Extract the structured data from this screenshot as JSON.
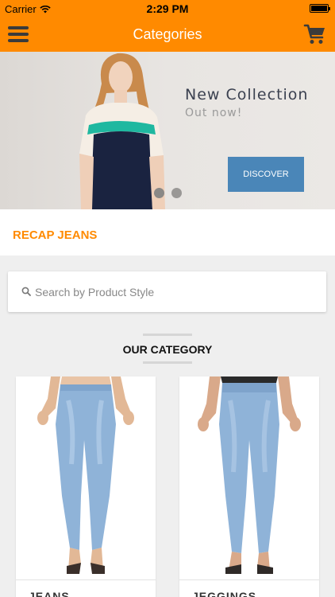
{
  "status_bar": {
    "carrier": "Carrier",
    "time": "2:29 PM"
  },
  "nav": {
    "title": "Categories",
    "menu_icon": "hamburger-menu-icon",
    "cart_icon": "shopping-cart-icon"
  },
  "banner": {
    "title": "New Collection",
    "subtitle": "Out now!",
    "button_label": "DISCOVER",
    "button_color": "#4a86b8"
  },
  "brand": {
    "name": "RECAP JEANS",
    "color": "#ff8a00"
  },
  "search": {
    "placeholder": "Search by Product Style",
    "value": ""
  },
  "category": {
    "heading": "OUR CATEGORY",
    "items": [
      {
        "label": "JEANS"
      },
      {
        "label": "JEGGINGS"
      }
    ]
  },
  "theme": {
    "accent": "#ff8a00",
    "background": "#efefef"
  }
}
